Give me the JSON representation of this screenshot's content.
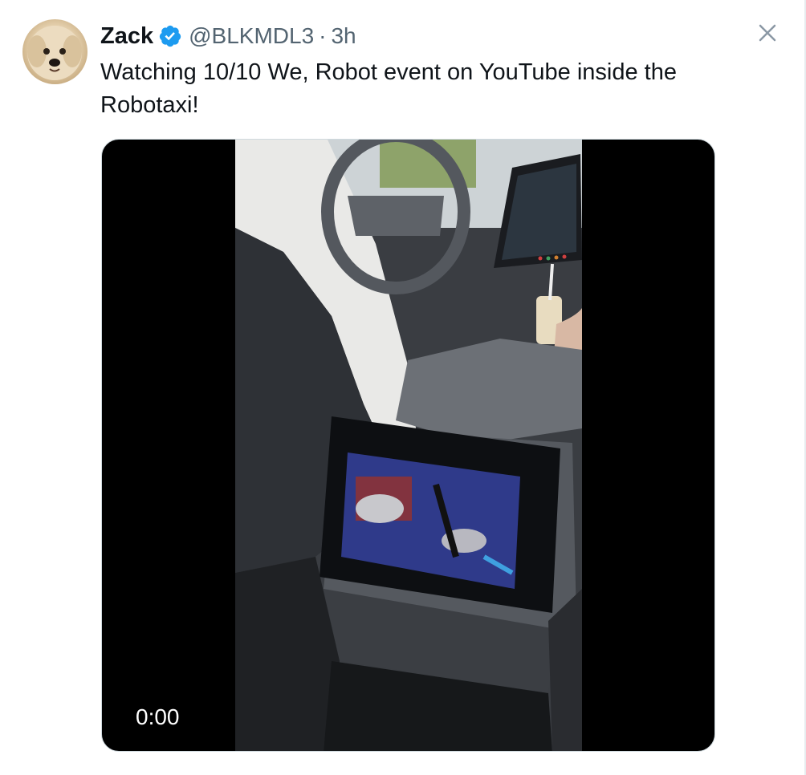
{
  "post": {
    "author_name": "Zack",
    "handle": "@BLKMDL3",
    "separator": "·",
    "time": "3h",
    "text": "Watching 10/10 We, Robot event on YouTube inside the Robotaxi!"
  },
  "video": {
    "timestamp": "0:00"
  },
  "icons": {
    "verified": "verified-badge-icon",
    "close": "close-icon"
  },
  "colors": {
    "verified_blue": "#1d9bf0",
    "text_primary": "#0f1419",
    "text_secondary": "#536471"
  }
}
